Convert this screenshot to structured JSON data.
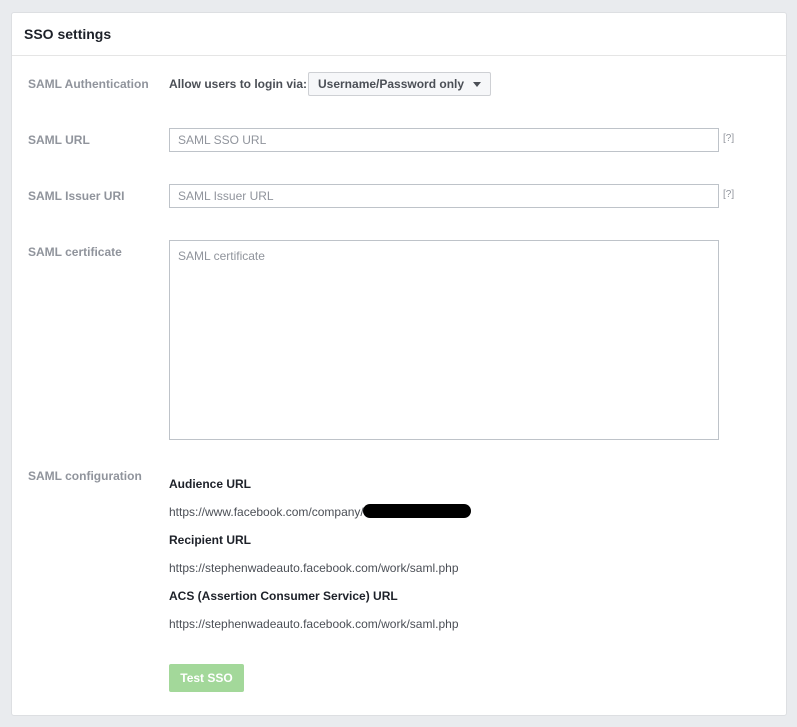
{
  "panel": {
    "title": "SSO settings"
  },
  "saml_auth": {
    "label": "SAML Authentication",
    "allow_text": "Allow users to login via:",
    "dropdown_value": "Username/Password only"
  },
  "saml_url": {
    "label": "SAML URL",
    "placeholder": "SAML SSO URL",
    "help": "[?]"
  },
  "saml_issuer": {
    "label": "SAML Issuer URI",
    "placeholder": "SAML Issuer URL",
    "help": "[?]"
  },
  "saml_cert": {
    "label": "SAML certificate",
    "placeholder": "SAML certificate"
  },
  "saml_config": {
    "label": "SAML configuration",
    "audience_heading": "Audience URL",
    "audience_value": "https://www.facebook.com/company/",
    "recipient_heading": "Recipient URL",
    "recipient_value": "https://stephenwadeauto.facebook.com/work/saml.php",
    "acs_heading": "ACS (Assertion Consumer Service) URL",
    "acs_value": "https://stephenwadeauto.facebook.com/work/saml.php"
  },
  "actions": {
    "test_label": "Test SSO"
  }
}
